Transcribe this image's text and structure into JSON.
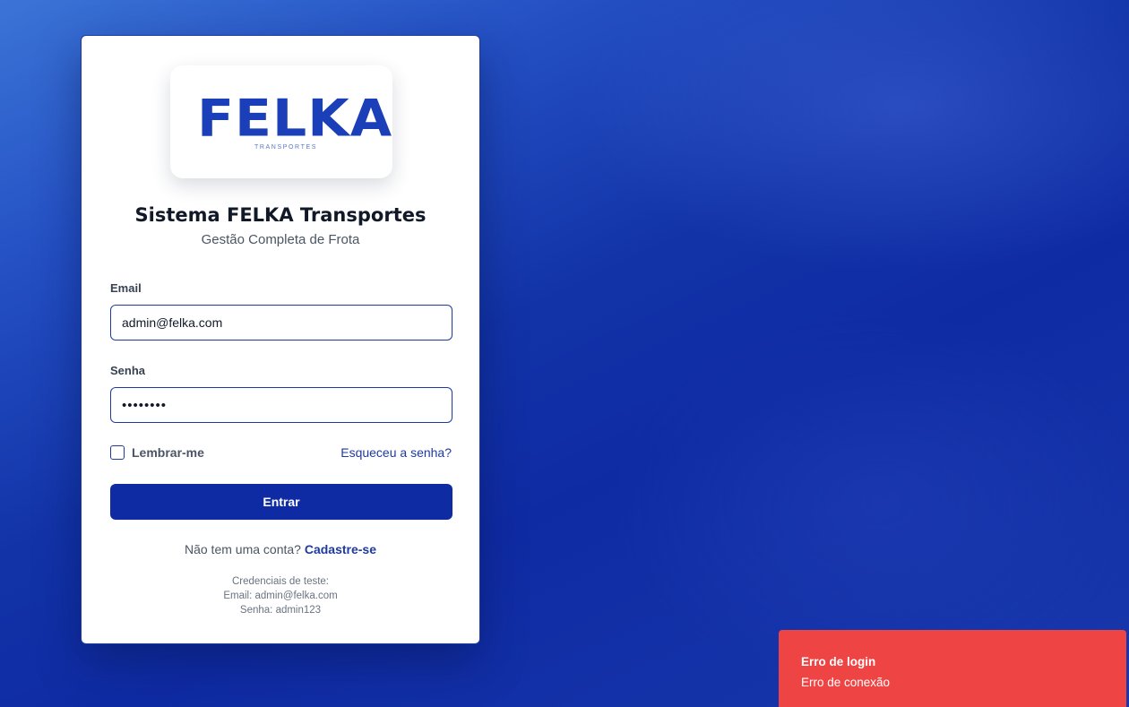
{
  "colors": {
    "brand": "#0f2ba4",
    "link": "#1e3aa0",
    "error": "#ef4444"
  },
  "logo": {
    "word": "FELKA",
    "tagline": "TRANSPORTES"
  },
  "header": {
    "title": "Sistema FELKA Transportes",
    "subtitle": "Gestão Completa de Frota"
  },
  "form": {
    "email_label": "Email",
    "email_value": "admin@felka.com",
    "password_label": "Senha",
    "password_value": "••••••••",
    "remember_label": "Lembrar-me",
    "remember_checked": false,
    "forgot_link": "Esqueceu a senha?",
    "submit_label": "Entrar"
  },
  "signup": {
    "prompt": "Não tem uma conta?",
    "link": "Cadastre-se"
  },
  "test_credentials": {
    "heading": "Credenciais de teste:",
    "email_line": "Email: admin@felka.com",
    "password_line": "Senha: admin123"
  },
  "toast": {
    "title": "Erro de login",
    "message": "Erro de conexão"
  }
}
